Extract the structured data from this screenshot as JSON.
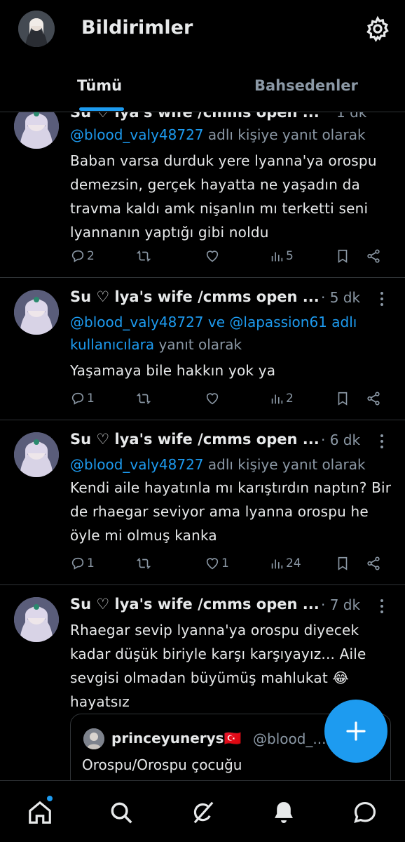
{
  "header": {
    "title": "Bildirimler",
    "tabs": [
      {
        "label": "Tümü",
        "active": true
      },
      {
        "label": "Bahsedenler",
        "active": false
      }
    ]
  },
  "colors": {
    "background": "#000000",
    "text": "#e7e9ea",
    "muted": "#8b98a5",
    "accent": "#1d9bf0",
    "divider": "#2f3336"
  },
  "tweets": [
    {
      "name": "Su ♡ lya's wife /cmms open ...",
      "time": "1 dk",
      "reply_prefix": "",
      "reply_users": "@blood_valy48727",
      "reply_suffix": " adlı kişiye yanıt olarak",
      "body": "Baban varsa durduk yere lyanna'ya orospu demezsin, gerçek hayatta ne yaşadın da travma kaldı amk nişanlın mı terketti seni lyannanın yaptığı gibi noldu",
      "replies": "2",
      "retweets": "",
      "likes": "",
      "views": "5"
    },
    {
      "name": "Su ♡ lya's wife /cmms open ...",
      "time": "· 5 dk",
      "reply_users": "@blood_valy48727 ve @lapassion61 adlı kullanıcılara",
      "reply_suffix": " yanıt olarak",
      "body": "Yaşamaya bile hakkın yok ya",
      "replies": "1",
      "retweets": "",
      "likes": "",
      "views": "2"
    },
    {
      "name": "Su ♡ lya's wife /cmms open ...",
      "time": "· 6 dk",
      "reply_users": "@blood_valy48727",
      "reply_suffix": " adlı kişiye yanıt olarak",
      "body": "Kendi aile hayatınla mı karıştırdın naptın? Bir de rhaegar seviyor ama lyanna orospu he öyle mi olmuş kanka",
      "replies": "1",
      "retweets": "",
      "likes": "1",
      "views": "24"
    },
    {
      "name": "Su ♡ lya's wife /cmms open ...",
      "time": "· 7 dk",
      "body": "Rhaegar sevip lyanna'ya orospu diyecek kadar düşük biriyle karşı karşıyayız... Aile sevgisi olmadan büyümüş mahlukat 😂 hayatsız",
      "quote": {
        "name": "princeyunerys🇹🇷",
        "handle": "@blood_...",
        "text": "Orospu/Orospu çocuğu"
      }
    }
  ],
  "nav": {
    "items": [
      "home-icon",
      "search-icon",
      "grok-icon",
      "bell-icon",
      "messages-icon"
    ],
    "home_has_dot": true
  }
}
